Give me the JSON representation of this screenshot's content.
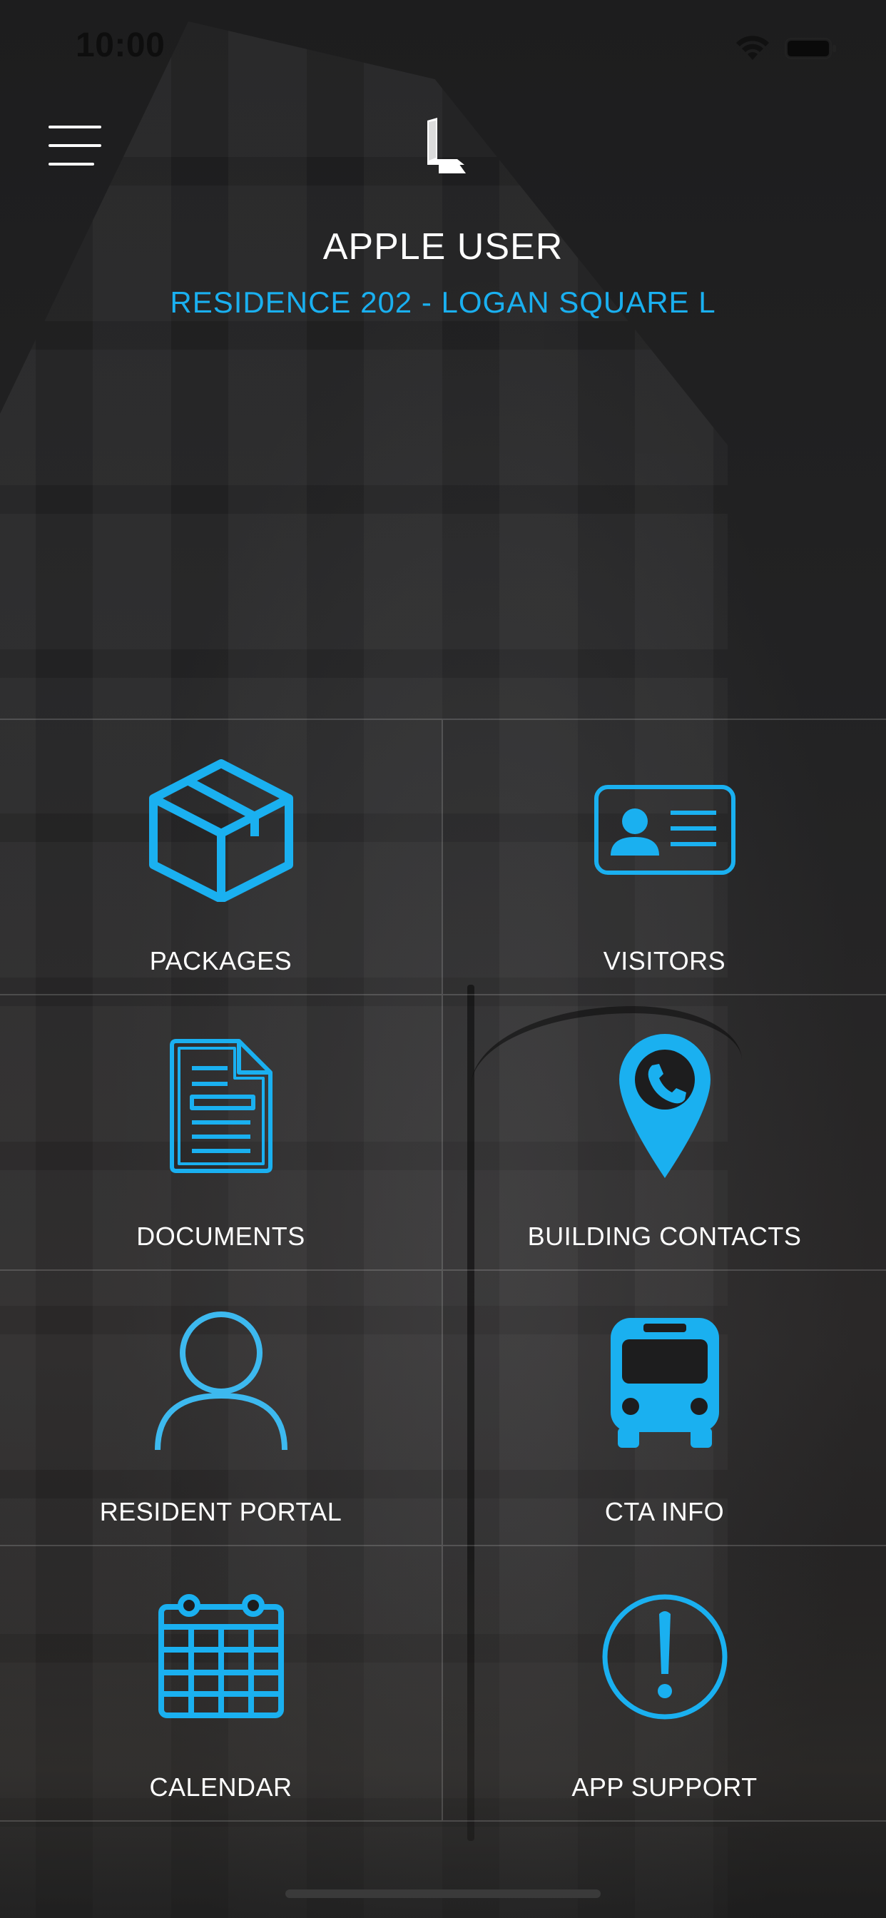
{
  "status_bar": {
    "time": "10:00"
  },
  "header": {
    "menu_icon": "hamburger-icon",
    "logo_icon": "l-logo-icon",
    "user_name": "APPLE USER",
    "residence": "RESIDENCE 202 - LOGAN SQUARE L"
  },
  "accent_color": "#1ab0f0",
  "menu_tiles": [
    {
      "label": "PACKAGES",
      "icon": "package-box-icon"
    },
    {
      "label": "VISITORS",
      "icon": "id-card-icon"
    },
    {
      "label": "DOCUMENTS",
      "icon": "document-icon"
    },
    {
      "label": "BUILDING CONTACTS",
      "icon": "location-phone-pin-icon"
    },
    {
      "label": "RESIDENT PORTAL",
      "icon": "person-icon"
    },
    {
      "label": "CTA INFO",
      "icon": "bus-icon"
    },
    {
      "label": "CALENDAR",
      "icon": "calendar-icon"
    },
    {
      "label": "APP SUPPORT",
      "icon": "exclamation-circle-icon"
    }
  ]
}
